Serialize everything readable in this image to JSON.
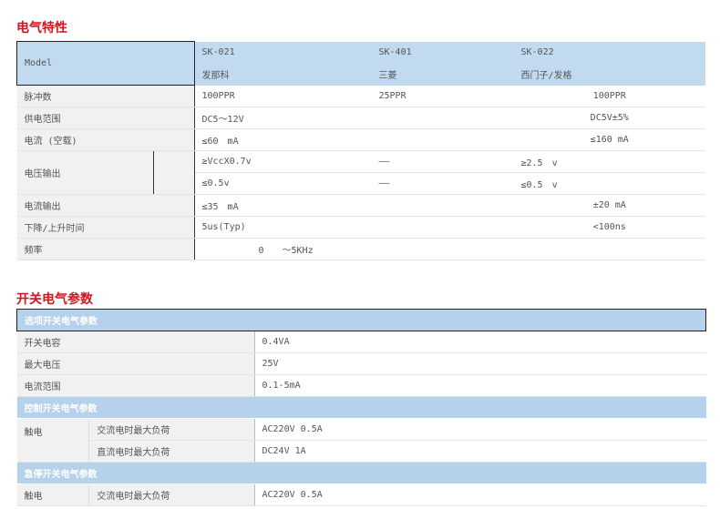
{
  "titles": {
    "electrical": "电气特性",
    "switch": "开关电气参数"
  },
  "spec": {
    "model_label": "Model",
    "models": [
      {
        "code": "SK-021",
        "brand": "发那科"
      },
      {
        "code": "SK-401",
        "brand": "三菱"
      },
      {
        "code": "SK-022",
        "brand": "西门子/发格"
      }
    ],
    "rows": {
      "pulse": {
        "label": "脉冲数",
        "v1": "100PPR",
        "v2": "25PPR",
        "v3": "100PPR"
      },
      "supply": {
        "label": "供电范围",
        "v1": "DC5～12V",
        "v3": "DC5V±5%"
      },
      "current": {
        "label": "电流 (空载)",
        "v1": "≤60　mA",
        "v3": "≤160 mA"
      },
      "voltage_out": {
        "label": "电压输出",
        "hi": {
          "v1": "≥VccX0.7v",
          "v2": "——",
          "v3": "≥2.5　v"
        },
        "lo": {
          "v1": "≤0.5v",
          "v2": "——",
          "v3": "≤0.5　v"
        }
      },
      "current_out": {
        "label": "电流输出",
        "v1": "≤35　mA",
        "v3": "±20 mA"
      },
      "rise": {
        "label": "下降/上升时间",
        "v1": "5us(Typ)",
        "v3": "<100ns"
      },
      "freq": {
        "label": "频率",
        "v1": "0　　～5KHz"
      }
    }
  },
  "switch": {
    "sec1": "选项开关电气参数",
    "capacity": {
      "label": "开关电容",
      "value": "0.4VA"
    },
    "max_v": {
      "label": "最大电压",
      "value": "25V"
    },
    "cur_range": {
      "label": "电流范围",
      "value": "0.1-5mA"
    },
    "sec2": "控制开关电气参数",
    "contact1": {
      "label": "触电",
      "ac_label": "交流电时最大负荷",
      "ac_value": "AC220V 0.5A",
      "dc_label": "直流电时最大负荷",
      "dc_value": "DC24V 1A"
    },
    "sec3": "急停开关电气参数",
    "contact2": {
      "label": "触电",
      "ac_label": "交流电时最大负荷",
      "ac_value": "AC220V 0.5A"
    }
  }
}
